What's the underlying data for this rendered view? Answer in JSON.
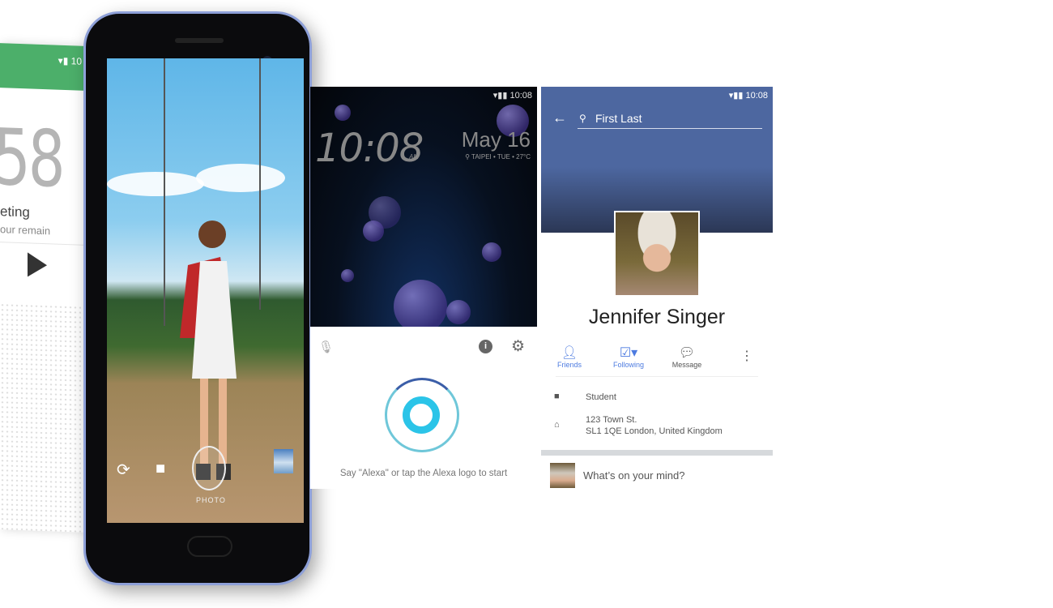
{
  "left_phone": {
    "status_time": "10",
    "big_number": "58",
    "title": "eting",
    "subtitle": "our remain",
    "icons": [
      "wifi-icon",
      "signal-icon",
      "battery-icon",
      "play-icon"
    ],
    "header_color": "#4caf6a"
  },
  "camera": {
    "mode_label": "PHOTO",
    "icons": [
      "switch-camera-icon",
      "video-icon",
      "shutter-button",
      "gallery-thumbnail"
    ]
  },
  "lock_screen": {
    "status_time": "10:08",
    "time": "10:08",
    "ampm": "AM",
    "date": "May 16",
    "location": "TAIPEI • TUE • 27°C",
    "icons": [
      "weather-sun-icon",
      "location-pin-icon"
    ]
  },
  "alexa": {
    "prompt": "Say \"Alexa\" or tap the Alexa logo to start",
    "icons": [
      "mic-off-icon",
      "info-icon",
      "gear-icon",
      "alexa-logo"
    ],
    "accent": "#2bc4e8"
  },
  "facebook": {
    "status_time": "10:08",
    "search_value": "First Last",
    "name": "Jennifer Singer",
    "actions": [
      {
        "label": "Friends",
        "icon": "friends-check-icon"
      },
      {
        "label": "Following",
        "icon": "following-icon"
      },
      {
        "label": "Message",
        "icon": "messenger-icon"
      }
    ],
    "occupation": "Student",
    "address_line1": "123 Town St.",
    "address_line2": "SL1 1QE London, United Kingdom",
    "composer_placeholder": "What’s on your mind?",
    "brand_color": "#4d67a0"
  }
}
